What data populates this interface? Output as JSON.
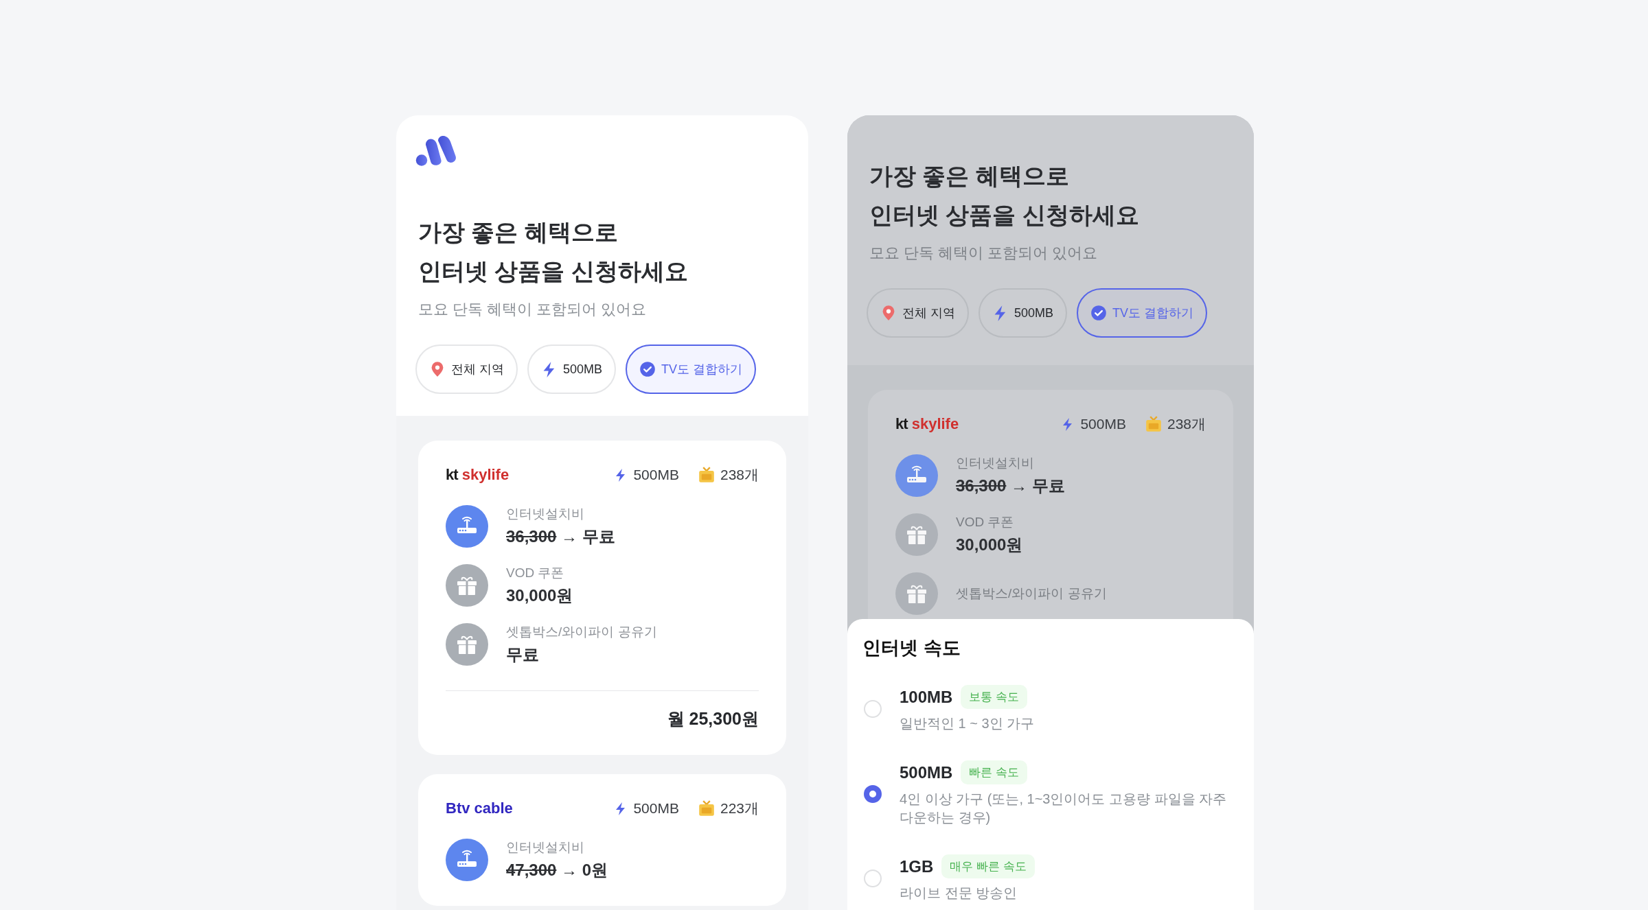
{
  "screens": [
    {
      "kind": "list",
      "header": {
        "title_lines": [
          "가장 좋은 혜택으로",
          "인터넷 상품을 신청하세요"
        ],
        "subtitle": "모요 단독 혜택이 포함되어 있어요"
      },
      "filters": [
        {
          "kind": "region",
          "label": "전체 지역",
          "selected": false
        },
        {
          "kind": "speed",
          "label": "500MB",
          "selected": false
        },
        {
          "kind": "check",
          "label": "TV도 결합하기",
          "selected": true
        }
      ],
      "plans": [
        {
          "kind": "kt",
          "brand": [
            "kt",
            "skylife"
          ],
          "speed": "500MB",
          "channels": "238개",
          "benefits": [
            {
              "kind": "router",
              "label": "인터넷설치비",
              "old": "36,300",
              "value": "→ 무료"
            },
            {
              "kind": "gift",
              "label": "VOD 쿠폰",
              "value": "30,000원"
            },
            {
              "kind": "gift",
              "label": "셋톱박스/와이파이 공유기",
              "value": "무료"
            }
          ],
          "price": "월 25,300원"
        },
        {
          "kind": "btv",
          "brand": [
            "Btv cable"
          ],
          "speed": "500MB",
          "channels": "223개",
          "benefits": [
            {
              "kind": "router",
              "label": "인터넷설치비",
              "old": "47,300",
              "value": "→ 0원"
            }
          ]
        }
      ]
    },
    {
      "kind": "filter_sheet",
      "header": {
        "title_lines": [
          "가장 좋은 혜택으로",
          "인터넷 상품을 신청하세요"
        ],
        "subtitle": "모요 단독 혜택이 포함되어 있어요"
      },
      "filters": [
        {
          "kind": "region",
          "label": "전체 지역",
          "selected": false
        },
        {
          "kind": "speed",
          "label": "500MB",
          "selected": false
        },
        {
          "kind": "check",
          "label": "TV도 결합하기",
          "selected": true
        }
      ],
      "plans": [
        {
          "kind": "kt",
          "brand": [
            "kt",
            "skylife"
          ],
          "speed": "500MB",
          "channels": "238개",
          "benefits": [
            {
              "kind": "router",
              "label": "인터넷설치비",
              "old": "36,300",
              "value": "→ 무료"
            },
            {
              "kind": "gift",
              "label": "VOD 쿠폰",
              "value": "30,000원"
            },
            {
              "kind": "gift",
              "label": "셋톱박스/와이파이 공유기"
            }
          ]
        }
      ],
      "sheet": {
        "title": "인터넷 속도",
        "options": [
          {
            "label": "100MB",
            "tag": "보통 속도",
            "desc": "일반적인 1 ~ 3인 가구",
            "selected": false
          },
          {
            "label": "500MB",
            "tag": "빠른 속도",
            "desc": "4인 이상 가구 (또는, 1~3인이어도 고용량 파일을 자주 다운하는 경우)",
            "selected": true
          },
          {
            "label": "1GB",
            "tag": "매우 빠른 속도",
            "desc": "라이브 전문 방송인",
            "selected": false
          }
        ]
      }
    }
  ]
}
